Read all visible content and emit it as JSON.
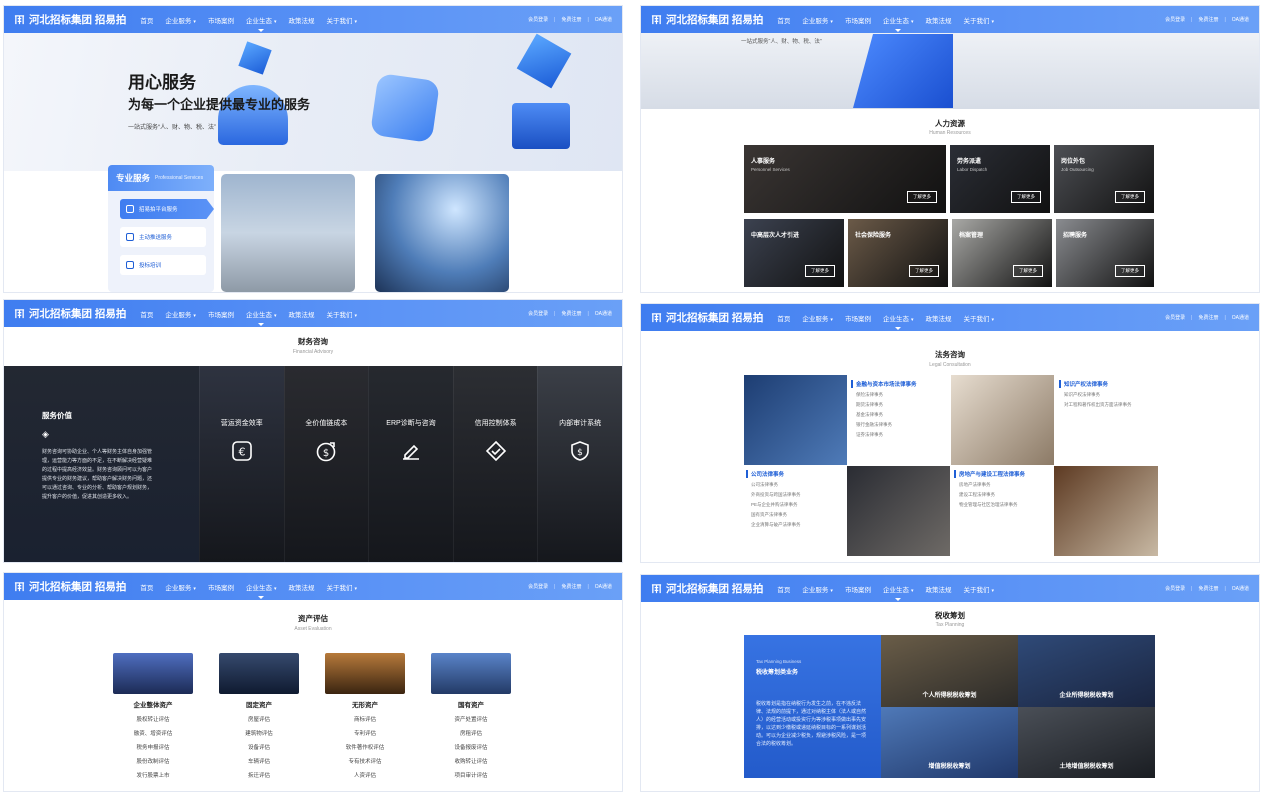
{
  "nav": {
    "logo_text": "河北招标集团 招易拍",
    "items": [
      {
        "label": "首页",
        "dropdown": false
      },
      {
        "label": "企业服务",
        "dropdown": true
      },
      {
        "label": "市场案例",
        "dropdown": false
      },
      {
        "label": "企业生态",
        "dropdown": true
      },
      {
        "label": "政策法规",
        "dropdown": false
      },
      {
        "label": "关于我们",
        "dropdown": true
      }
    ],
    "right": [
      "会员登录",
      "免费注册",
      "OA通道"
    ]
  },
  "hero": {
    "title": "用心服务",
    "subtitle": "为每一个企业提供最专业的服务",
    "tagline": "一站式服务“人、财、物、税、法”"
  },
  "services": {
    "title": "专业服务",
    "title_en": "Professional Services",
    "items": [
      "招易拍平台服务",
      "主动推送服务",
      "投标培训"
    ]
  },
  "hr": {
    "tagline": "一站式服务“人、财、物、税、法”",
    "title": "人力资源",
    "title_en": "Human Resources",
    "more_label": "了解更多",
    "tiles": [
      {
        "title": "人事服务",
        "en": "Personnel Services"
      },
      {
        "title": "劳务派遣",
        "en": "Labor Dispatch"
      },
      {
        "title": "岗位外包",
        "en": "Job Outsourcing"
      },
      {
        "title": "中高层次人才引进",
        "en": ""
      },
      {
        "title": "社会保险服务",
        "en": ""
      },
      {
        "title": "档案管理",
        "en": ""
      },
      {
        "title": "招聘服务",
        "en": ""
      }
    ]
  },
  "finance": {
    "title": "财务咨询",
    "title_en": "Financial Advisory",
    "intro_title": "服务价值",
    "intro_text": "财务咨询可协助企业、个人等财务主体自身加强管理，运营能力等方面的不足，在不断解决经营疑难的过程中提高经济效益。财务咨询顾问可以为客户提供专业的财务建议，帮助客户解决财务问题，还可以通过咨询、专业的分析、帮助客户规划财务，提升客户的价值，促进其创造更多收入。",
    "columns": [
      {
        "title": "营运资金效率",
        "icon": "euro-icon"
      },
      {
        "title": "全价值链成本",
        "icon": "dollar-arrow-icon"
      },
      {
        "title": "ERP诊断与咨询",
        "icon": "edit-icon"
      },
      {
        "title": "信用控制体系",
        "icon": "diamond-check-icon"
      },
      {
        "title": "内部审计系统",
        "icon": "shield-dollar-icon"
      }
    ]
  },
  "legal": {
    "title": "法务咨询",
    "title_en": "Legal Consultation",
    "blocks": [
      {
        "title": "金融与资本市场法律事务",
        "items": [
          "保险法律事务",
          "期货法律事务",
          "基金法律事务",
          "银行金融法律事务",
          "证券法律事务"
        ]
      },
      {
        "title": "知识产权法律事务",
        "items": [
          "知识产权法律事务",
          "对工程和著作权出资方面法律事务"
        ]
      },
      {
        "title": "公司法律事务",
        "items": [
          "公司法律事务",
          "外商投资与跨国法律事务",
          "PE与企业并购法律事务",
          "国有资产法律事务",
          "企业清算与破产法律事务"
        ]
      },
      {
        "title": "房地产与建设工程法律事务",
        "items": [
          "房地产法律事务",
          "建设工程法律事务",
          "物业管理与社区治理法律事务"
        ]
      }
    ]
  },
  "asset": {
    "title": "资产评估",
    "title_en": "Asset Evaluation",
    "columns": [
      {
        "title": "企业整体资产",
        "items": [
          "股权转让评估",
          "融资、增资评估",
          "税务申报评估",
          "股份改制评估",
          "发行股票上市"
        ]
      },
      {
        "title": "固定资产",
        "items": [
          "房屋评估",
          "建筑物评估",
          "设备评估",
          "车辆评估",
          "拆迁评估"
        ]
      },
      {
        "title": "无形资产",
        "items": [
          "商标评估",
          "专利评估",
          "软件著作权评估",
          "专有技术评估",
          "人资评估"
        ]
      },
      {
        "title": "国有资产",
        "items": [
          "资产处置评估",
          "房租评估",
          "设备报废评估",
          "收购转让评估",
          "项目审计评估"
        ]
      }
    ]
  },
  "tax": {
    "title": "税收筹划",
    "title_en": "Tax Planning",
    "card_en": "Tax Planning Business",
    "card_title": "税收筹划类业务",
    "card_text": "税收筹划是指在纳税行为发生之前，在不违反法律、法规的前提下，通过对纳税主体（法人或自然人）的经营活动或投资行为等涉税事项做出事先安排，以达到少缴税或递延纳税目标的一系列谋划活动。可以为企业减少税负，规避涉税风险，是一项合法的税收筹划。",
    "cells": [
      "个人所得税税收筹划",
      "企业所得税税收筹划",
      "增值税税收筹划",
      "土地增值税税收筹划"
    ]
  },
  "colors": {
    "brand_blue": "#3f7df0",
    "link_blue": "#1f5fd6",
    "dark_bg": "#1c1f26"
  }
}
